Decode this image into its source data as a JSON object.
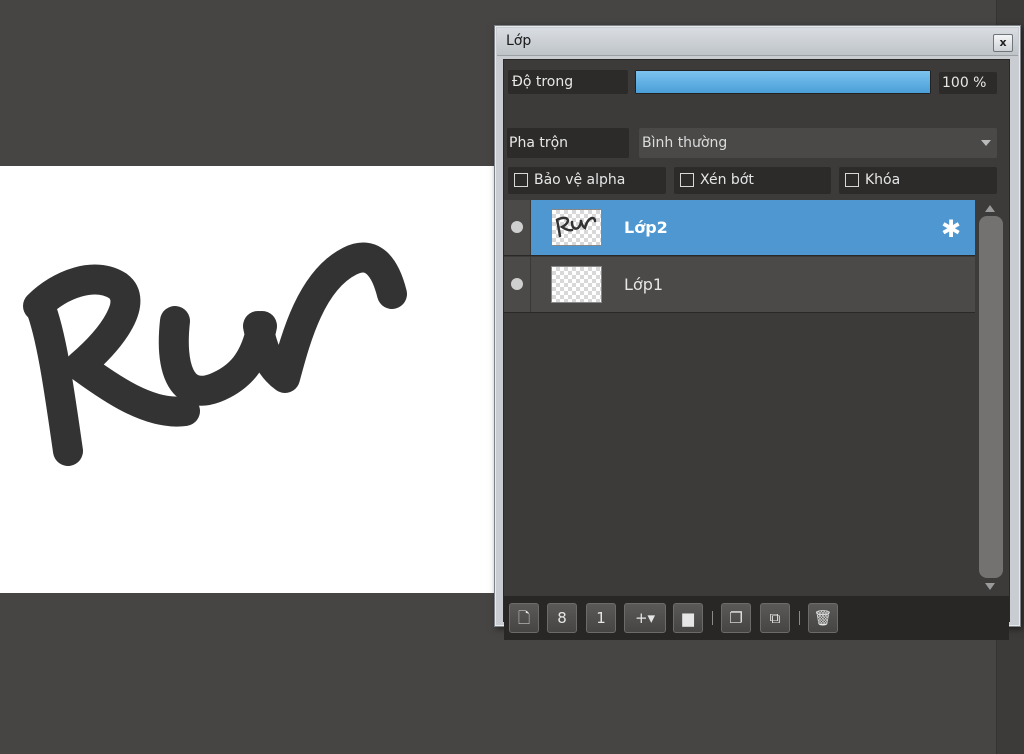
{
  "canvas": {
    "stroke_color": "#333333",
    "paper_color": "#ffffff",
    "drawing_text": "Run"
  },
  "panel": {
    "title": "Lớp",
    "close_label": "x",
    "opacity_label": "Độ trong",
    "opacity_percent": 100,
    "opacity_value_text": "100 %",
    "blend_label": "Pha trộn",
    "blend_value": "Bình thường",
    "checkboxes": [
      {
        "label": "Bảo vệ alpha",
        "checked": false
      },
      {
        "label": "Xén bớt",
        "checked": false
      },
      {
        "label": "Khóa",
        "checked": false
      }
    ],
    "layers": [
      {
        "name": "Lớp2",
        "active": true,
        "thumbnail_text": "Run"
      },
      {
        "name": "Lớp1",
        "active": false
      }
    ],
    "toolbar": [
      {
        "icon": "new-layer-icon",
        "glyph": "🗋"
      },
      {
        "icon": "new-8bit-layer-icon",
        "glyph": "8"
      },
      {
        "icon": "new-1bit-layer-icon",
        "glyph": "1"
      },
      {
        "icon": "add-layer-dropdown-icon",
        "glyph": "+▾"
      },
      {
        "icon": "folder-icon",
        "glyph": "▆"
      },
      {
        "icon": "duplicate-layer-icon",
        "glyph": "❐"
      },
      {
        "icon": "merge-down-icon",
        "glyph": "⧉"
      },
      {
        "icon": "delete-layer-icon",
        "glyph": "🗑"
      }
    ],
    "accent_color": "#4f97d0"
  }
}
